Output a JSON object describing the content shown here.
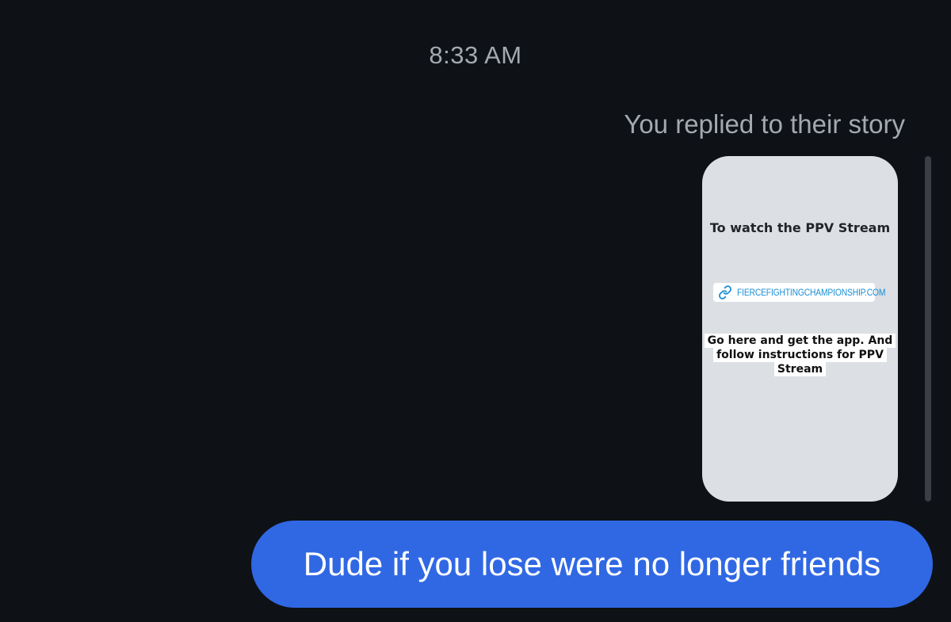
{
  "conversation": {
    "timestamp": "8:33 AM",
    "reply_context": "You replied to their story"
  },
  "story": {
    "title": "To watch the PPV Stream",
    "link_label": "FIERCEFIGHTINGCHAMPIONSHIP.COM",
    "link_icon": "link-icon",
    "caption": "Go here and get the app. And follow instructions for PPV Stream"
  },
  "message": {
    "text": "Dude if you lose were no longer friends"
  },
  "colors": {
    "background": "#0e1116",
    "bubble": "#3068e4",
    "story_card": "#dcdfe3",
    "link": "#1a8fd6",
    "secondary_text": "#a4a9b1"
  }
}
